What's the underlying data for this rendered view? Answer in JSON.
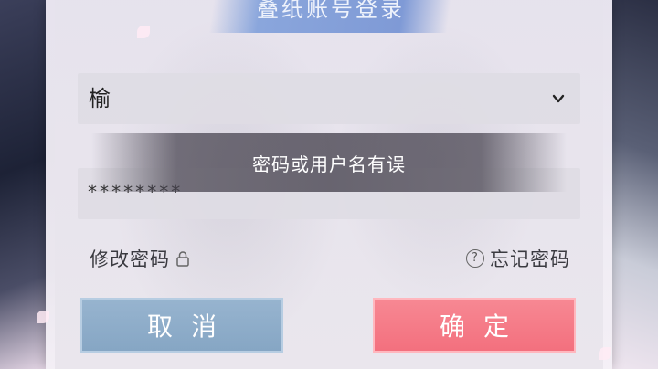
{
  "dialog": {
    "title": "叠纸账号登录"
  },
  "account": {
    "value": "榆"
  },
  "password": {
    "value": "********"
  },
  "toast": {
    "message": "密码或用户名有误"
  },
  "links": {
    "change_password": "修改密码",
    "forgot_password": "忘记密码"
  },
  "buttons": {
    "cancel": "取消",
    "confirm": "确定"
  },
  "icons": {
    "account_dropdown": "chevron-down-icon",
    "change_password": "lock-icon",
    "forgot_password": "help-circle-icon"
  },
  "colors": {
    "cancel_button": "#8eaccb",
    "confirm_button": "#f57b88",
    "title_banner": "#8aa6dc"
  }
}
